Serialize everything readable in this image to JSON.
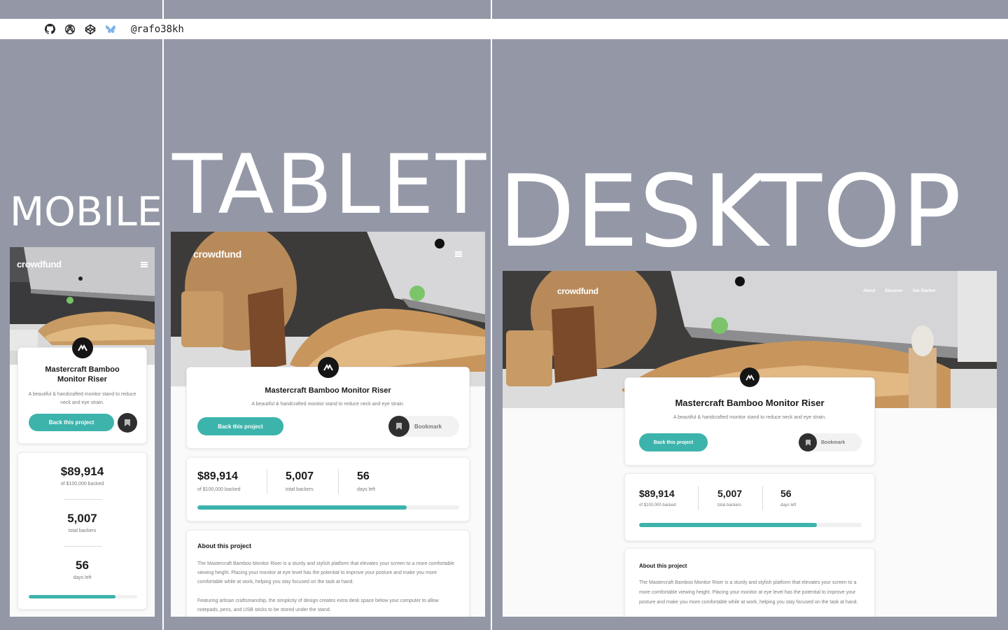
{
  "author": {
    "handle": "@rafo38kh"
  },
  "topbar_icons": [
    "github-icon",
    "openai-icon",
    "codepen-icon",
    "bluesky-icon"
  ],
  "labels": {
    "mobile": "MOBILE",
    "tablet": "TABLET",
    "desktop": "DESKTOP"
  },
  "site": {
    "logo": "crowdfund",
    "nav": [
      "About",
      "Discover",
      "Get Started"
    ]
  },
  "project": {
    "title": "Mastercraft Bamboo Monitor Riser",
    "description": "A beautiful & handcrafted monitor stand to reduce neck and eye strain.",
    "back_label": "Back this project",
    "bookmark_label": "Bookmark"
  },
  "stats": {
    "backed_amount": "$89,914",
    "backed_label": "of $100,000 backed",
    "backers": "5,007",
    "backers_label": "total backers",
    "days": "56",
    "days_label": "days left",
    "progress_pct": 80
  },
  "about": {
    "heading": "About this project",
    "p1": "The Mastercraft Bamboo Monitor Riser is a sturdy and stylish platform that elevates your screen to a more comfortable viewing height. Placing your monitor at eye level has the potential to improve your posture and make you more comfortable while at work, helping you stay focused on the task at hand.",
    "p2": "Featuring artisan craftsmanship, the simplicity of design creates extra desk space below your computer to allow notepads, pens, and USB sticks to be stored under the stand."
  },
  "colors": {
    "accent": "#3cb3ab",
    "page_bg": "#9498a6",
    "dark": "#151515"
  }
}
